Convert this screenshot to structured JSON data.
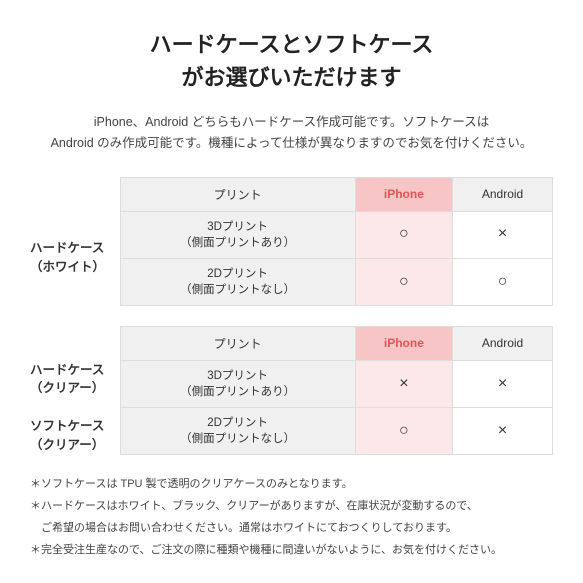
{
  "title": {
    "line1": "ハードケースとソフトケース",
    "line2": "がお選びいただけます"
  },
  "description": "iPhone、Android どちらもハードケース作成可能です。ソフトケースは\nAndroid のみ作成可能です。機種によって仕様が異なりますのでお気を付けください。",
  "table1": {
    "row_header": "ハードケース\n（ホワイト）",
    "col_headers": [
      "プリント",
      "iPhone",
      "Android"
    ],
    "rows": [
      {
        "print": "3Dプリント\n（側面プリントあり）",
        "iphone": "○",
        "android": "×"
      },
      {
        "print": "2Dプリント\n（側面プリントなし）",
        "iphone": "○",
        "android": "○"
      }
    ]
  },
  "table2": {
    "row_header_line1": "ハードケース",
    "row_header_line2": "（クリアー）",
    "row_header_line3": "ソフトケース",
    "row_header_line4": "（クリアー）",
    "col_headers": [
      "プリント",
      "iPhone",
      "Android"
    ],
    "rows": [
      {
        "print": "3Dプリント\n（側面プリントあり）",
        "iphone": "×",
        "android": "×"
      },
      {
        "print": "2Dプリント\n（側面プリントなし）",
        "iphone": "○",
        "android": "×"
      }
    ]
  },
  "notes": [
    "＊ソフトケースは TPU 製で透明のクリアケースのみとなります。",
    "＊ハードケースはホワイト、ブラック、クリアーがありますが、在庫状況が変動するので、",
    "　ご希望の場合はお問い合わせください。通常はホワイトにておつくりしております。",
    "＊完全受注生産なので、ご注文の際に種類や機種に間違いがないように、お気を付けください。"
  ]
}
